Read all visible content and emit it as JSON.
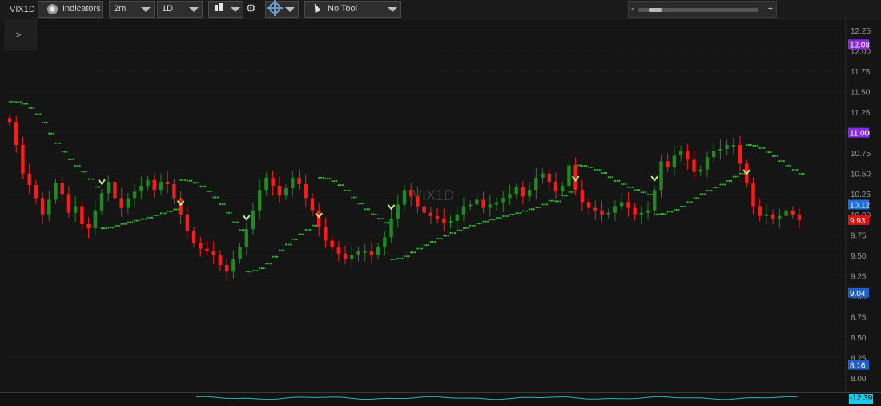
{
  "toolbar": {
    "symbol": "VIX1D",
    "indicators_label": "Indicators",
    "interval": "2m",
    "range": "1D",
    "tool": "No Tool",
    "zoom_minus": "-",
    "zoom_plus": "+",
    "zoom_level": 0.1
  },
  "panel": {
    "expand_label": ">"
  },
  "icons": [
    "indicators-icon",
    "chevron-down-icon",
    "candlestick-icon",
    "gear-icon",
    "crosshair-icon",
    "cursor-icon",
    "expand-icon"
  ],
  "colors": {
    "up": "#1f8a1f",
    "down": "#ff1a1a",
    "sar": "#2fbf2f",
    "signal": "#b8f08a",
    "background": "#151515"
  },
  "chart_data": {
    "type": "candlestick",
    "watermark": "VIX1D",
    "ylim": [
      8.0,
      12.25
    ],
    "yticks": [
      "12.25",
      "12.00",
      "11.75",
      "11.50",
      "11.25",
      "11.00",
      "10.75",
      "10.50",
      "10.25",
      "10.00",
      "9.75",
      "9.50",
      "9.25",
      "9.00",
      "8.75",
      "8.50",
      "8.25",
      "8.00"
    ],
    "price_badges": [
      {
        "value": "12.08",
        "color": "#8a2be2"
      },
      {
        "value": "11.00",
        "color": "#8a2be2"
      },
      {
        "value": "10.12",
        "color": "#1e6fd9"
      },
      {
        "value": "9.93",
        "color": "#e01010"
      },
      {
        "value": "9.04",
        "color": "#1e5fc9"
      },
      {
        "value": "8.16",
        "color": "#1e5fc9"
      }
    ],
    "lower_indicator_value": "-12.39",
    "series": {
      "closes": [
        11.13,
        10.85,
        10.5,
        10.36,
        10.2,
        10.0,
        10.18,
        10.39,
        10.25,
        10.02,
        10.1,
        9.88,
        9.83,
        10.05,
        10.26,
        10.4,
        10.2,
        10.08,
        10.2,
        10.28,
        10.35,
        10.42,
        10.3,
        10.4,
        10.37,
        10.2,
        10.0,
        9.8,
        9.65,
        9.58,
        9.55,
        9.5,
        9.38,
        9.3,
        9.45,
        9.6,
        9.82,
        10.05,
        10.3,
        10.45,
        10.35,
        10.23,
        10.32,
        10.45,
        10.37,
        10.2,
        10.05,
        9.85,
        9.68,
        9.6,
        9.52,
        9.45,
        9.5,
        9.55,
        9.55,
        9.5,
        9.6,
        9.72,
        9.95,
        10.12,
        10.3,
        10.22,
        10.1,
        10.02,
        9.98,
        9.95,
        9.9,
        9.92,
        10.0,
        10.1,
        10.12,
        10.18,
        10.08,
        10.12,
        10.15,
        10.2,
        10.25,
        10.33,
        10.22,
        10.3,
        10.45,
        10.5,
        10.4,
        10.28,
        10.35,
        10.6,
        10.3,
        10.15,
        10.08,
        10.05,
        10.0,
        10.02,
        10.1,
        10.15,
        10.08,
        10.0,
        10.02,
        10.05,
        10.3,
        10.65,
        10.58,
        10.72,
        10.78,
        10.67,
        10.52,
        10.55,
        10.7,
        10.78,
        10.8,
        10.85,
        10.85,
        10.62,
        10.38,
        10.1,
        9.98,
        10.0,
        9.95,
        9.98,
        10.05,
        10.0,
        9.93
      ]
    }
  }
}
